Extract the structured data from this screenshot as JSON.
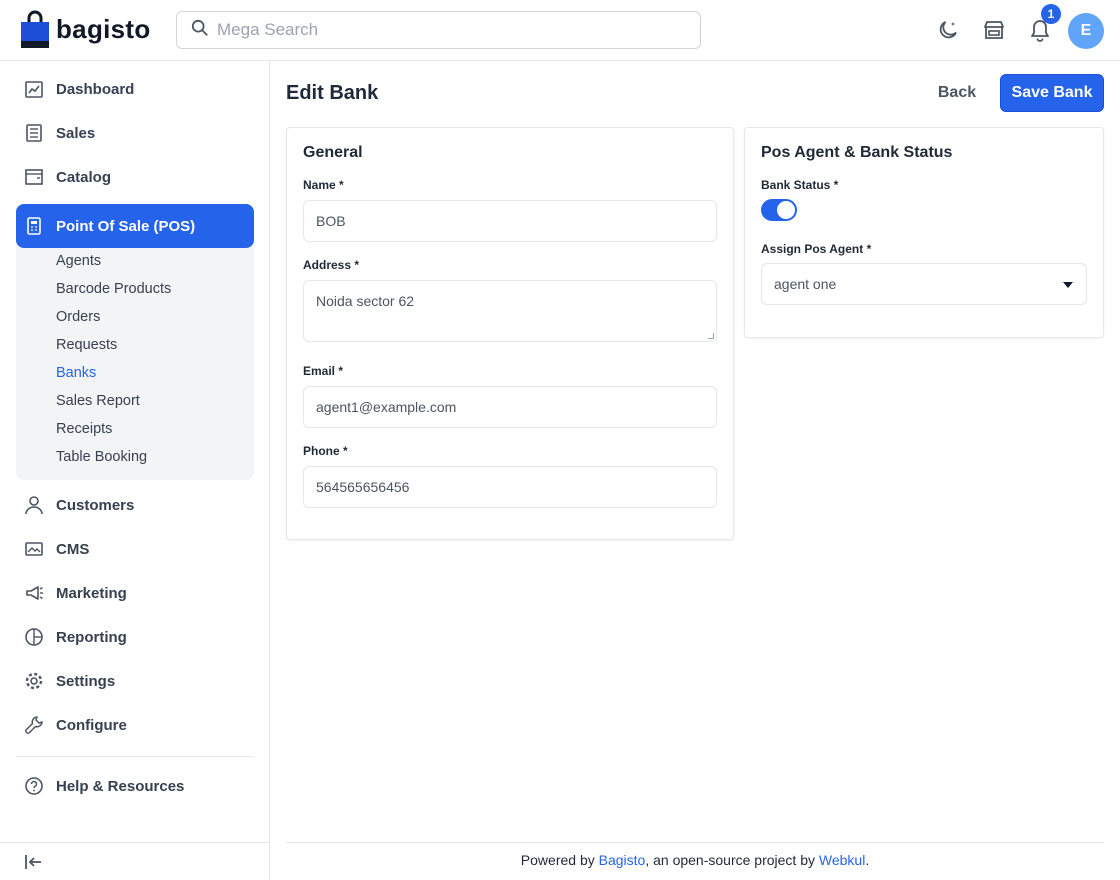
{
  "header": {
    "logo_text": "bagisto",
    "search_placeholder": "Mega Search",
    "notification_count": "1",
    "avatar_initial": "E",
    "colors": {
      "accent": "#2563eb",
      "avatar": "#60a5fa"
    }
  },
  "sidebar": {
    "items": [
      {
        "label": "Dashboard",
        "icon": "dashboard-icon"
      },
      {
        "label": "Sales",
        "icon": "sales-icon"
      },
      {
        "label": "Catalog",
        "icon": "catalog-icon"
      },
      {
        "label": "Point Of Sale (POS)",
        "icon": "pos-icon",
        "active": true
      },
      {
        "label": "Customers",
        "icon": "customers-icon"
      },
      {
        "label": "CMS",
        "icon": "cms-icon"
      },
      {
        "label": "Marketing",
        "icon": "marketing-icon"
      },
      {
        "label": "Reporting",
        "icon": "reporting-icon"
      },
      {
        "label": "Settings",
        "icon": "settings-icon"
      },
      {
        "label": "Configure",
        "icon": "configure-icon"
      },
      {
        "label": "Help & Resources",
        "icon": "help-icon"
      }
    ],
    "pos_sub_items": [
      {
        "label": "Agents"
      },
      {
        "label": "Barcode Products"
      },
      {
        "label": "Orders"
      },
      {
        "label": "Requests"
      },
      {
        "label": "Banks",
        "active": true
      },
      {
        "label": "Sales Report"
      },
      {
        "label": "Receipts"
      },
      {
        "label": "Table Booking"
      }
    ]
  },
  "page": {
    "title": "Edit Bank",
    "back_label": "Back",
    "save_label": "Save Bank"
  },
  "general": {
    "title": "General",
    "name_label": "Name *",
    "name_value": "BOB",
    "address_label": "Address *",
    "address_value": "Noida sector 62",
    "email_label": "Email *",
    "email_value": "agent1@example.com",
    "phone_label": "Phone *",
    "phone_value": "564565656456"
  },
  "status_card": {
    "title": "Pos Agent & Bank Status",
    "bank_status_label": "Bank Status *",
    "bank_status_on": true,
    "assign_agent_label": "Assign Pos Agent *",
    "assign_agent_value": "agent one"
  },
  "footer": {
    "prefix": "Powered by ",
    "link1": "Bagisto",
    "middle": ", an open-source project by ",
    "link2": "Webkul",
    "suffix": "."
  }
}
